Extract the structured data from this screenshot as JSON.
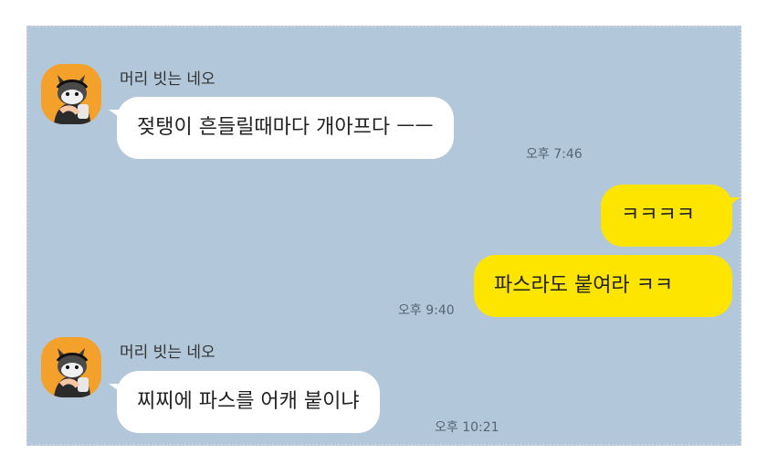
{
  "messages": [
    {
      "sender": "머리 빗는 네오",
      "text": "젖탱이 흔들릴때마다 개아프다 ㅡㅡ",
      "time": "오후 7:46"
    },
    {
      "text": "ㅋㅋㅋㅋ"
    },
    {
      "text": "파스라도 붙여라 ㅋㅋ",
      "time": "오후 9:40"
    },
    {
      "sender": "머리 빗는 네오",
      "text": "찌찌에 파스를 어캐 붙이냐",
      "time": "오후 10:21"
    }
  ],
  "colors": {
    "chat_background": "#b2c7da",
    "incoming_bubble": "#ffffff",
    "outgoing_bubble": "#fee500",
    "avatar_background": "#f4a12b"
  },
  "icons": {
    "avatar": "neo-character-avatar-icon"
  }
}
